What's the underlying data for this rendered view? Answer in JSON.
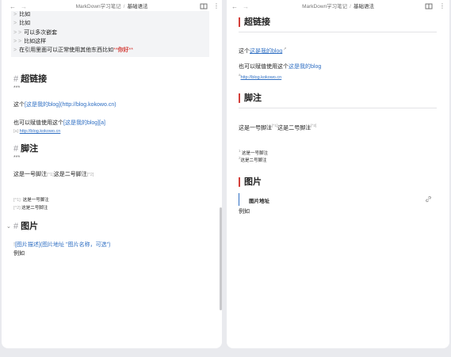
{
  "left": {
    "breadcrumb": {
      "parent": "MarkDown学习笔记",
      "sep": "/",
      "current": "基础语法"
    },
    "quote_lines": [
      {
        "mark": ">",
        "text": "比如"
      },
      {
        "mark": ">",
        "text": "比如"
      },
      {
        "mark": "> >",
        "text": "可以多次嵌套"
      },
      {
        "mark": "> >",
        "text": "比如这样"
      },
      {
        "mark": ">",
        "text": "在引用里面可以正常使用其他东西比如",
        "bold_marks": "**",
        "bold_text": "你好"
      }
    ],
    "sections": {
      "hyperlink": {
        "hash": "#",
        "title": "超链接",
        "rule": "***",
        "line1_pre": "这个",
        "line1_link": "[这是我的blog](http://blog.kokowo.cn)",
        "line2_pre": "也可以赋值使用这个",
        "line2_link": "[这是我的blog][a]",
        "ref_label": "[a]:",
        "ref_url": "http://blog.kokowo.cn"
      },
      "footnote": {
        "hash": "#",
        "title": "脚注",
        "rule": "***",
        "line": "这是一号脚注",
        "mark1": "[^1]",
        "line_mid": "这是二号脚注",
        "mark2": "[^2]",
        "def1_mark": "[^1]:",
        "def1_text": "这是一号脚注",
        "def2_mark": "[^2]:",
        "def2_text": "这是二号脚注"
      },
      "image": {
        "hash": "#",
        "title": "图片",
        "syntax_bang": "!",
        "syntax_alt": "[图片描述]",
        "syntax_src": "(图片地址 \"图片名称，可选\")",
        "example": "例如"
      }
    }
  },
  "right": {
    "breadcrumb": {
      "parent": "MarkDown学习笔记",
      "sep": "/",
      "current": "基础语法"
    },
    "hyperlink": {
      "title": "超链接",
      "line1_pre": "这个",
      "line1_link": "这是我的blog",
      "line2_pre": "也可以赋值使用这个",
      "line2_link": "这是我的blog",
      "ref_label": "a",
      "ref_url": "http://blog.kokowo.cn"
    },
    "footnote": {
      "title": "脚注",
      "line": "这是一号脚注",
      "sup1": "[^1]",
      "line_mid": "这是二号脚注",
      "sup2": "[^2]",
      "def1_num": "1",
      "def1_text": "这是一号脚注",
      "def2_num": "2",
      "def2_text": "这是二号脚注"
    },
    "image": {
      "title": "图片",
      "card_title": "图片地址",
      "example": "例如"
    }
  },
  "icons": {
    "nav_back": "arrow-left-icon",
    "nav_forward": "arrow-right-icon",
    "split_view": "book-open-icon",
    "more": "more-vertical-icon",
    "fold": "chevron-down-icon",
    "external": "external-link-icon",
    "link": "link-icon"
  },
  "colors": {
    "accent_red": "#d43f3a",
    "link_blue": "#2f6fc3"
  }
}
